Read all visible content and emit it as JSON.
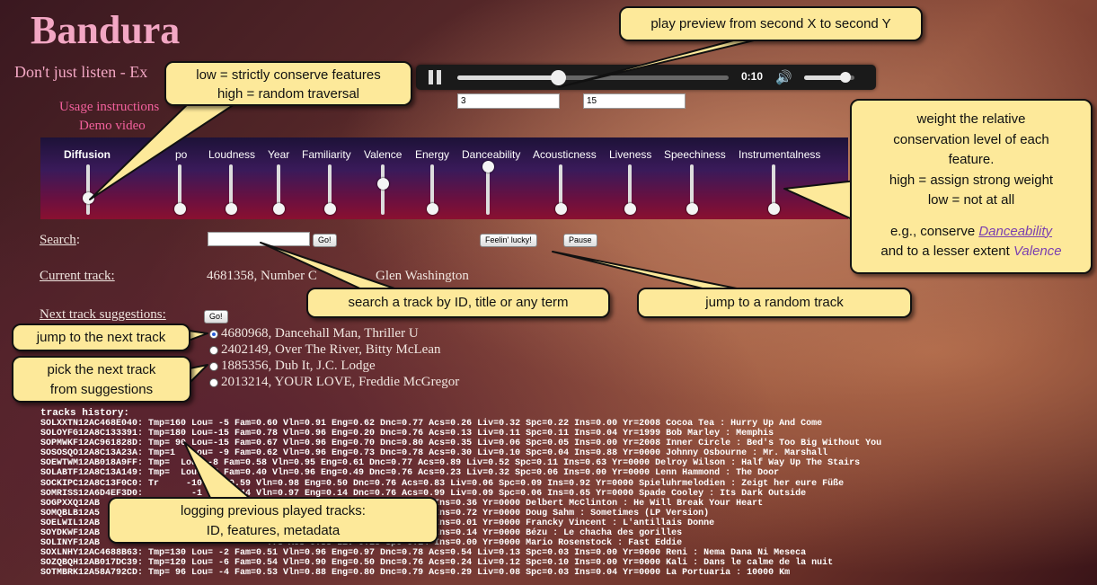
{
  "app": {
    "title": "Bandura",
    "tagline": "Don't just listen - Ex",
    "links": {
      "usage": "Usage instructions",
      "demo": "Demo video"
    }
  },
  "player": {
    "time": "0:10",
    "progress": 0.37,
    "volume": 0.82,
    "from_seconds": "3",
    "to_seconds": "15",
    "icons": {
      "pause": "pause-icon",
      "volume": "speaker-icon"
    }
  },
  "features": [
    {
      "label": "Diffusion",
      "level": 0.25
    },
    {
      "label": "po",
      "level": 0.0
    },
    {
      "label": "Loudness",
      "level": 0.0
    },
    {
      "label": "Year",
      "level": 0.0
    },
    {
      "label": "Familiarity",
      "level": 0.0
    },
    {
      "label": "Valence",
      "level": 0.6
    },
    {
      "label": "Energy",
      "level": 0.0
    },
    {
      "label": "Danceability",
      "level": 1.0
    },
    {
      "label": "Acousticness",
      "level": 0.0
    },
    {
      "label": "Liveness",
      "level": 0.0
    },
    {
      "label": "Speechiness",
      "level": 0.0
    },
    {
      "label": "Instrumentalness",
      "level": 0.0
    }
  ],
  "search": {
    "label": "Search",
    "colon": ":",
    "go": "Go!",
    "feelin_lucky": "Feelin' lucky!",
    "pause": "Pause"
  },
  "current_track": {
    "label": "Current track:",
    "value_start": "4681358, Number C",
    "value_end": "Glen Washington"
  },
  "next": {
    "label": "Next track suggestions:",
    "go": "Go!",
    "items": [
      {
        "text": "4680968, Dancehall Man, Thriller U",
        "checked": true
      },
      {
        "text": "2402149, Over The River, Bitty McLean",
        "checked": false
      },
      {
        "text": "1885356, Dub It, J.C. Lodge",
        "checked": false
      },
      {
        "text": "2013214, YOUR LOVE, Freddie McGregor",
        "checked": false
      }
    ]
  },
  "history": {
    "title": "tracks history:",
    "rows": [
      "SOLXXTN12AC468E040: Tmp=160 Lou= -5 Fam=0.60 Vln=0.91 Eng=0.62 Dnc=0.77 Acs=0.26 Liv=0.32 Spc=0.22 Ins=0.00 Yr=2008 Cocoa Tea : Hurry Up And Come",
      "SOLOYFG12A8C133391: Tmp=180 Lou=-15 Fam=0.78 Vln=0.96 Eng=0.20 Dnc=0.76 Acs=0.13 Liv=0.11 Spc=0.11 Ins=0.04 Yr=1999 Bob Marley : Memphis",
      "SOPMWKF12AC961828D: Tmp= 90 Lou=-15 Fam=0.67 Vln=0.96 Eng=0.70 Dnc=0.80 Acs=0.35 Liv=0.06 Spc=0.05 Ins=0.00 Yr=2008 Inner Circle : Bed's Too Big Without You",
      "SOSOSQO12A8C13A23A: Tmp=1   Lou= -9 Fam=0.62 Vln=0.96 Eng=0.73 Dnc=0.78 Acs=0.30 Liv=0.10 Spc=0.04 Ins=0.88 Yr=0000 Johnny Osbourne : Mr. Marshall",
      "SOEWTWM12AB018A9FF: Tmp=  Lou= -8 Fam=0.58 Vln=0.95 Eng=0.61 Dnc=0.77 Acs=0.89 Liv=0.52 Spc=0.11 Ins=0.63 Yr=0000 Delroy Wilson : Half Way Up The Stairs",
      "SOLABTF12A8C13A149: Tmp=  Lou= -7 Fam=0.40 Vln=0.96 Eng=0.49 Dnc=0.76 Acs=0.23 Liv=0.32 Spc=0.06 Ins=0.00 Yr=0000 Lenn Hammond : The Door",
      "SOCKIPC12A8C13F0C0: Tr     -10 Fam=0.59 Vln=0.98 Eng=0.50 Dnc=0.76 Acs=0.83 Liv=0.06 Spc=0.09 Ins=0.92 Yr=0000 Spieluhrmelodien : Zeigt her eure Füße",
      "SOMRISS12A6D4EF3D0:         -1 Fam=0.44 Vln=0.97 Eng=0.14 Dnc=0.76 Acs=0.99 Liv=0.09 Spc=0.06 Ins=0.65 Yr=0000 Spade Cooley : Its Dark Outside",
      "SOGPXXQ12AB                               .76 Acs=0.39 Liv=0.13 Spc=0.04 Ins=0.36 Yr=0000 Delbert McClinton : He Will Break Your Heart",
      "SOMQBLB12A5                               .76 Acs=0.81 Liv=0.10 Spc=0.05 Ins=0.72 Yr=0000 Doug Sahm : Sometimes (LP Version)",
      "SOELWIL12AB                               .76 Acs=0.36 Liv=0.07 Spc=0.05 Ins=0.01 Yr=0000 Francky Vincent : L'antillais Donne",
      "SOYDKWF12AB                               .76 Acs=0.91 Liv=0.35 Spc=0.03 Ins=0.14 Yr=0000 Bézu : Le chacha des gorilles",
      "SOLINYF12AB                               .78 Acs=0.88 Liv=0.13 Spc=0.14 Ins=0.00 Yr=0000 Mario Rosenstock : Fast Eddie",
      "SOXLNHY12AC4688B63: Tmp=130 Lou= -2 Fam=0.51 Vln=0.96 Eng=0.97 Dnc=0.78 Acs=0.54 Liv=0.13 Spc=0.03 Ins=0.00 Yr=0000 Reni : Nema Dana Ni Meseca",
      "SOZQBQH12AB017DC39: Tmp=120 Lou= -6 Fam=0.54 Vln=0.90 Eng=0.50 Dnc=0.76 Acs=0.24 Liv=0.12 Spc=0.10 Ins=0.00 Yr=0000 Kali : Dans le calme de la nuit",
      "SOTMBRK12A58A792CD: Tmp= 96 Lou= -4 Fam=0.53 Vln=0.88 Eng=0.80 Dnc=0.79 Acs=0.29 Liv=0.08 Spc=0.03 Ins=0.04 Yr=0000 La Portuaria : 10000 Km"
    ]
  },
  "callouts": {
    "preview": "play preview from second X to second Y",
    "diffusion_l1": "low = strictly conserve features",
    "diffusion_l2": "high = random traversal",
    "weights_l1": "weight the relative",
    "weights_l2": "conservation level of each",
    "weights_l3": "feature.",
    "weights_l4": "high = assign strong weight",
    "weights_l5": "low = not at all",
    "weights_eg_pre": "e.g., conserve ",
    "weights_eg_dance": "Danceability",
    "weights_eg_mid": "and to a lesser extent ",
    "weights_eg_val": "Valence",
    "search": "search a track by ID, title  or any term",
    "random": "jump to a random track",
    "next": "jump to the next track",
    "pick_l1": "pick the next track",
    "pick_l2": "from suggestions",
    "log_l1": "logging previous played tracks:",
    "log_l2": "ID, features, metadata"
  }
}
